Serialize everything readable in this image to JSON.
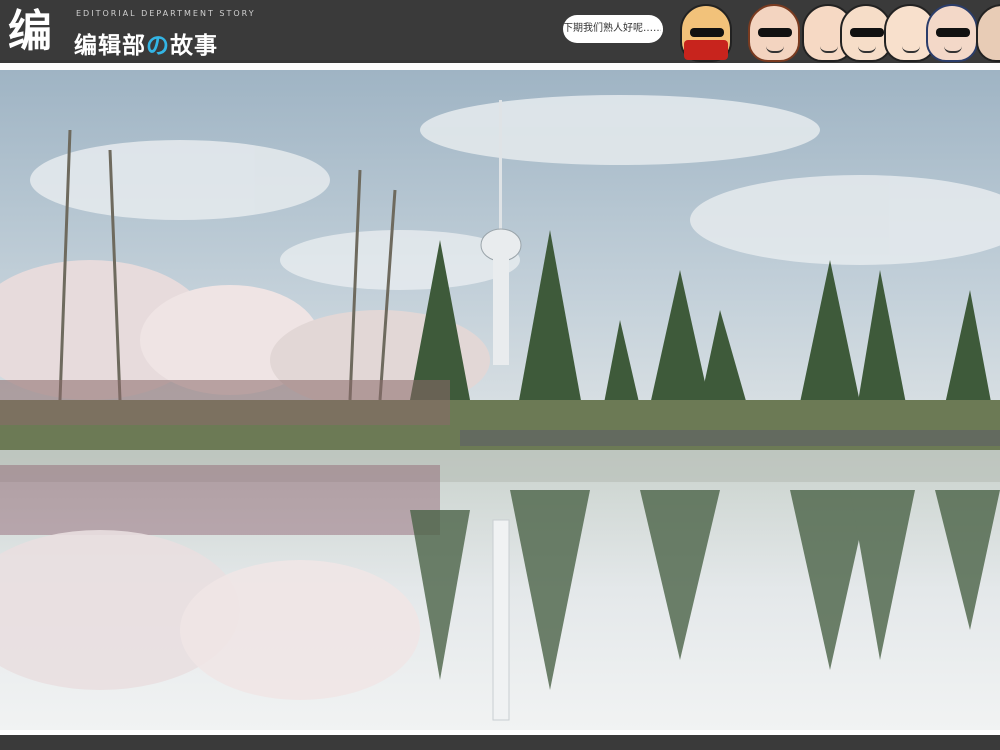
{
  "header": {
    "logo_mark": "编",
    "subtitle": "EDITORIAL DEPARTMENT STORY",
    "title_part1": "编辑部",
    "title_accent": "の",
    "title_part2": "故事",
    "speech_bubble": "下期我们熟人好呢……"
  },
  "colors": {
    "header_bg": "#3a3a3a",
    "accent": "#33b5e5",
    "footer_bg": "#3a3a3a"
  },
  "icons": {
    "characters": [
      "character-red-scarf-icon",
      "character-woman-glasses-icon",
      "character-man-bald-icon",
      "character-man-glasses-icon",
      "character-man-smile-icon",
      "character-woman-hair-icon"
    ]
  }
}
